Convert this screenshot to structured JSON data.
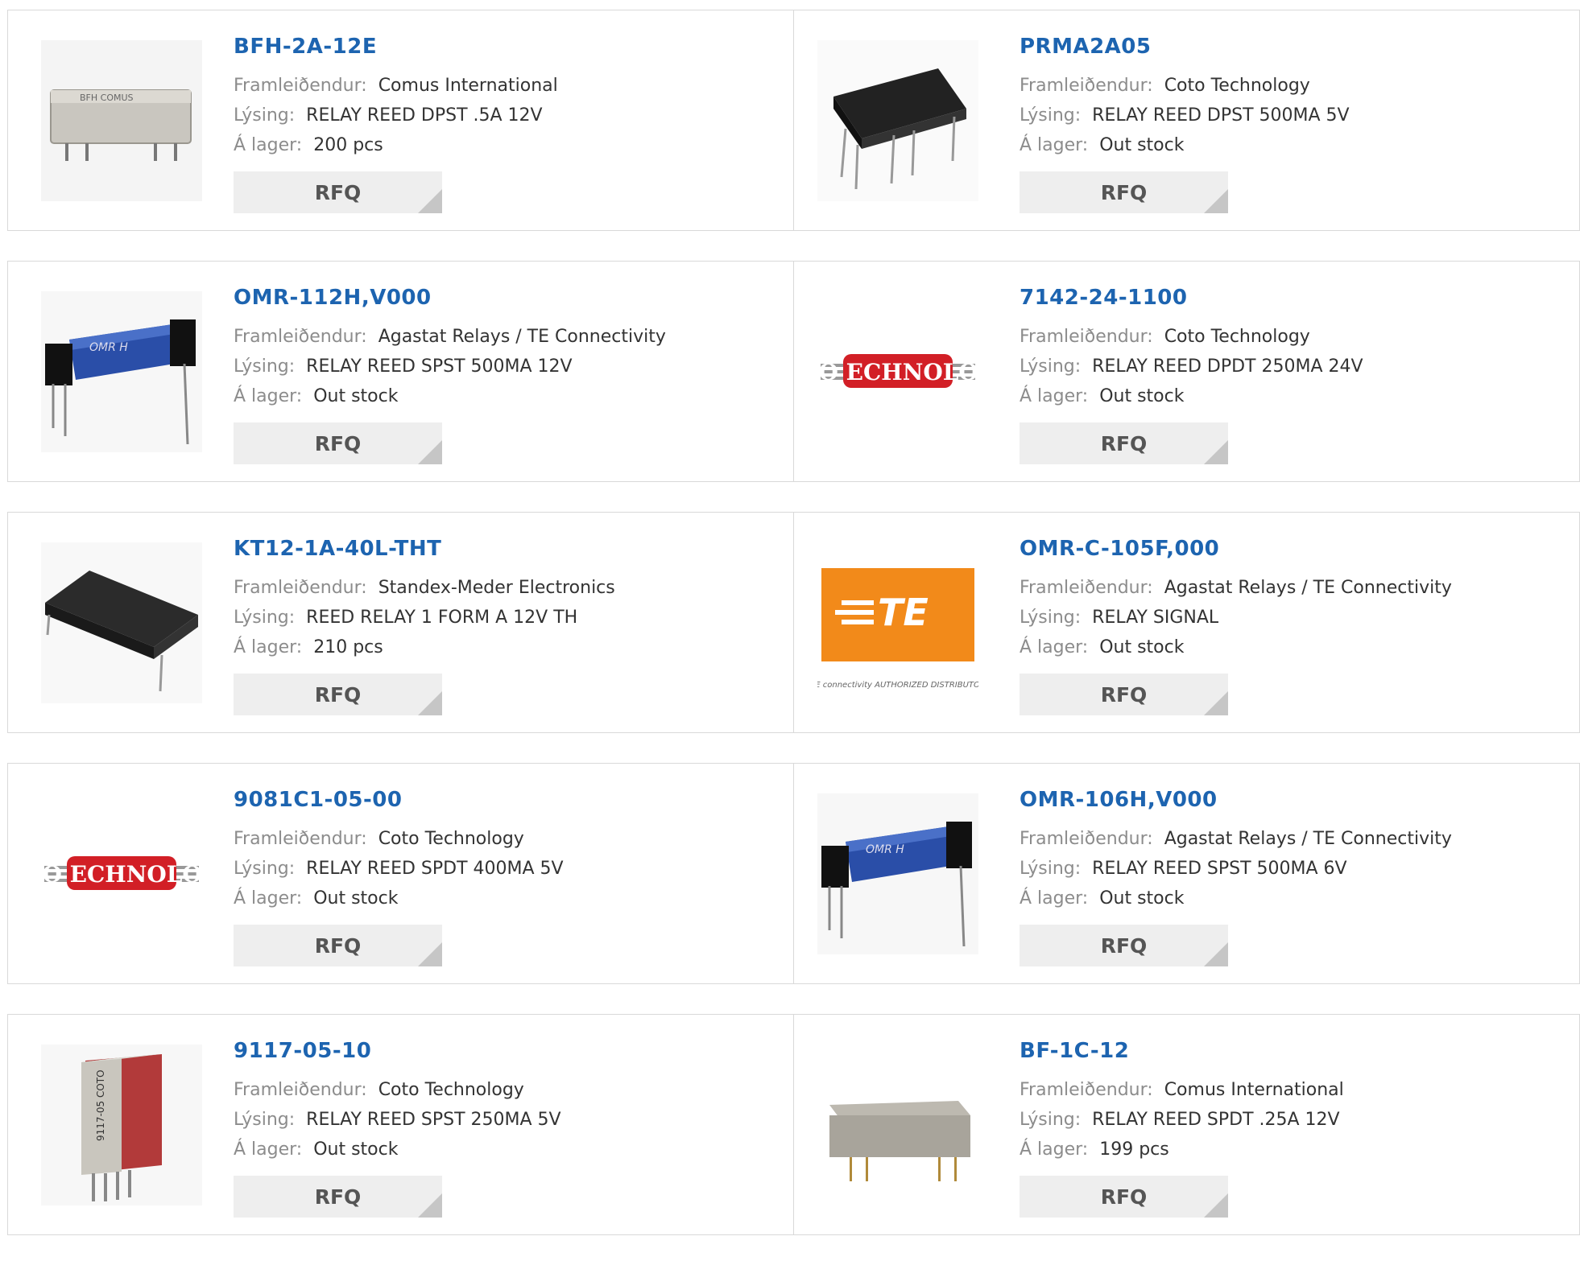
{
  "labels": {
    "manufacturer": "Framleiðendur:",
    "description": "Lýsing:",
    "stock": "Á lager:",
    "rfq": "RFQ"
  },
  "products": [
    {
      "part": "BFH-2A-12E",
      "manufacturer": "Comus International",
      "description": "RELAY REED DPST .5A 12V",
      "stock": "200 pcs",
      "image": "relay-silver-icon",
      "image_text": "BFH COMUS"
    },
    {
      "part": "PRMA2A05",
      "manufacturer": "Coto Technology",
      "description": "RELAY REED DPST 500MA 5V",
      "stock": "Out stock",
      "image": "relay-black-icon"
    },
    {
      "part": "OMR-112H,V000",
      "manufacturer": "Agastat Relays / TE Connectivity",
      "description": "RELAY REED SPST 500MA 12V",
      "stock": "Out stock",
      "image": "relay-blue-icon",
      "image_text": "OMR H"
    },
    {
      "part": "7142-24-1100",
      "manufacturer": "Coto Technology",
      "description": "RELAY REED DPDT 250MA 24V",
      "stock": "Out stock",
      "image": "coto-logo-icon",
      "image_text": "OTO ECHNOLOGY"
    },
    {
      "part": "KT12-1A-40L-THT",
      "manufacturer": "Standex-Meder Electronics",
      "description": "REED RELAY 1 FORM A 12V TH",
      "stock": "210 pcs",
      "image": "relay-black-long-icon"
    },
    {
      "part": "OMR-C-105F,000",
      "manufacturer": "Agastat Relays / TE Connectivity",
      "description": "RELAY SIGNAL",
      "stock": "Out stock",
      "image": "te-logo-icon",
      "image_text": "TE connectivity AUTHORIZED DISTRIBUTOR"
    },
    {
      "part": "9081C1-05-00",
      "manufacturer": "Coto Technology",
      "description": "RELAY REED SPDT 400MA 5V",
      "stock": "Out stock",
      "image": "coto-logo-icon",
      "image_text": "OTO ECHNOLOGY"
    },
    {
      "part": "OMR-106H,V000",
      "manufacturer": "Agastat Relays / TE Connectivity",
      "description": "RELAY REED SPST 500MA 6V",
      "stock": "Out stock",
      "image": "relay-blue-icon",
      "image_text": "OMR H"
    },
    {
      "part": "9117-05-10",
      "manufacturer": "Coto Technology",
      "description": "RELAY REED SPST 250MA 5V",
      "stock": "Out stock",
      "image": "relay-red-icon",
      "image_text": "9117-05 COTO"
    },
    {
      "part": "BF-1C-12",
      "manufacturer": "Comus International",
      "description": "RELAY REED SPDT .25A 12V",
      "stock": "199 pcs",
      "image": "relay-silver-icon"
    }
  ]
}
